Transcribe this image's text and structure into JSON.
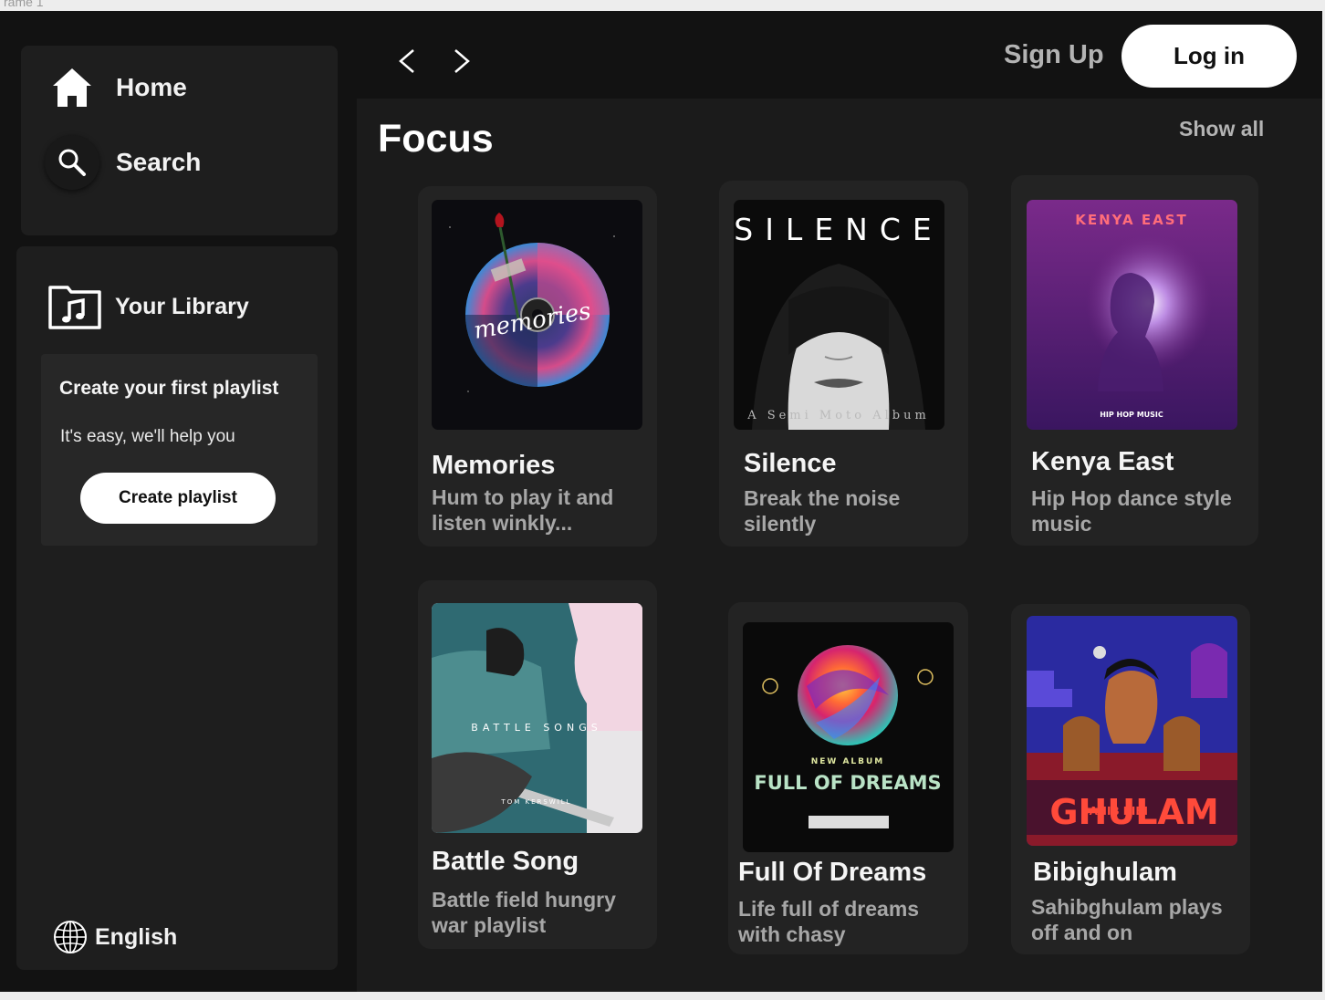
{
  "frame_label": "rame 1",
  "sidebar": {
    "nav": [
      {
        "label": "Home",
        "icon": "home-icon"
      },
      {
        "label": "Search",
        "icon": "search-icon"
      }
    ],
    "library": {
      "title": "Your Library",
      "icon": "library-icon",
      "create_box": {
        "title": "Create your first playlist",
        "subtitle": "It's easy, we'll help you",
        "button": "Create playlist"
      }
    },
    "language": {
      "label": "English",
      "icon": "globe-icon"
    }
  },
  "topbar": {
    "back_icon": "chevron-left-icon",
    "forward_icon": "chevron-right-icon",
    "signup": "Sign Up",
    "login": "Log in"
  },
  "section": {
    "title": "Focus",
    "show_all": "Show all",
    "cards": [
      {
        "title": "Memories",
        "description": "Hum to play it and listen winkly...",
        "cover_text": "memories"
      },
      {
        "title": "Silence",
        "description": "Break the  noise silently",
        "cover_text": "SILENCE",
        "cover_subtext": "A Semi Moto Album"
      },
      {
        "title": "Kenya East",
        "description": "Hip Hop dance style music",
        "cover_text": "KENYA EAST",
        "cover_subtext": "HIP HOP MUSIC"
      },
      {
        "title": "Battle Song",
        "description": "Battle field hungry war playlist",
        "cover_text": "BATTLE SONGS",
        "cover_subtext": "TOM KERSWILL"
      },
      {
        "title": "Full Of Dreams",
        "description": "Life full of dreams with chasy",
        "cover_text": "FULL OF DREAMS",
        "cover_subtext": "NEW ALBUM"
      },
      {
        "title": "Bibighulam",
        "description": "Sahibghulam plays off and on",
        "cover_text": "GHULAM",
        "cover_subtext": "SAHIB BIBI"
      }
    ]
  },
  "colors": {
    "app_bg": "#121212",
    "panel_bg": "#1e1e1e",
    "main_bg": "#1b1b1b",
    "card_bg": "#232323",
    "muted_text": "#a7a7a7"
  }
}
